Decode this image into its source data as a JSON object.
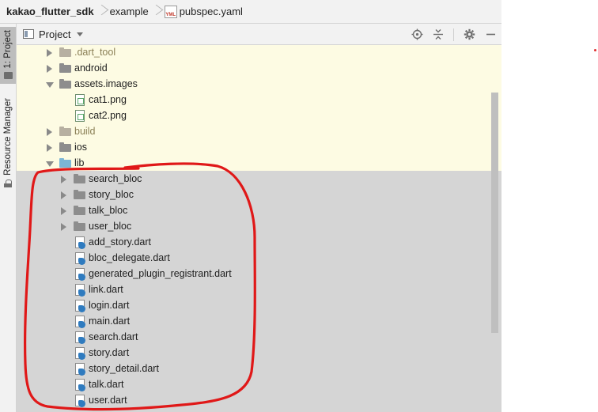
{
  "breadcrumb": {
    "items": [
      "kakao_flutter_sdk",
      "example",
      "pubspec.yaml"
    ],
    "yml_icon_text": "YML"
  },
  "tool_strip": {
    "project_tab": "1: Project",
    "resource_tab": "Resource Manager"
  },
  "panel": {
    "title": "Project",
    "actions": [
      "locate-icon",
      "collapse-all-icon",
      "gear-icon",
      "minimize-icon"
    ]
  },
  "tree": {
    "rows": [
      {
        "label": ".dart_tool",
        "kind": "folder",
        "expanded": false
      },
      {
        "label": "android",
        "kind": "folder",
        "expanded": false
      },
      {
        "label": "assets.images",
        "kind": "folder",
        "expanded": true
      },
      {
        "label": "cat1.png",
        "kind": "png"
      },
      {
        "label": "cat2.png",
        "kind": "png"
      },
      {
        "label": "build",
        "kind": "folder",
        "expanded": false
      },
      {
        "label": "ios",
        "kind": "folder",
        "expanded": false
      },
      {
        "label": "lib",
        "kind": "folder",
        "expanded": true
      },
      {
        "label": "search_bloc",
        "kind": "folder",
        "expanded": false
      },
      {
        "label": "story_bloc",
        "kind": "folder",
        "expanded": false
      },
      {
        "label": "talk_bloc",
        "kind": "folder",
        "expanded": false
      },
      {
        "label": "user_bloc",
        "kind": "folder",
        "expanded": false
      },
      {
        "label": "add_story.dart",
        "kind": "dart"
      },
      {
        "label": "bloc_delegate.dart",
        "kind": "dart"
      },
      {
        "label": "generated_plugin_registrant.dart",
        "kind": "dart"
      },
      {
        "label": "link.dart",
        "kind": "dart"
      },
      {
        "label": "login.dart",
        "kind": "dart"
      },
      {
        "label": "main.dart",
        "kind": "dart"
      },
      {
        "label": "search.dart",
        "kind": "dart"
      },
      {
        "label": "story.dart",
        "kind": "dart"
      },
      {
        "label": "story_detail.dart",
        "kind": "dart"
      },
      {
        "label": "talk.dart",
        "kind": "dart"
      },
      {
        "label": "user.dart",
        "kind": "dart"
      }
    ]
  },
  "colors": {
    "annotation": "#e01818",
    "excluded_bg": "#fdfbe3",
    "selected_bg": "#d5d5d5"
  }
}
